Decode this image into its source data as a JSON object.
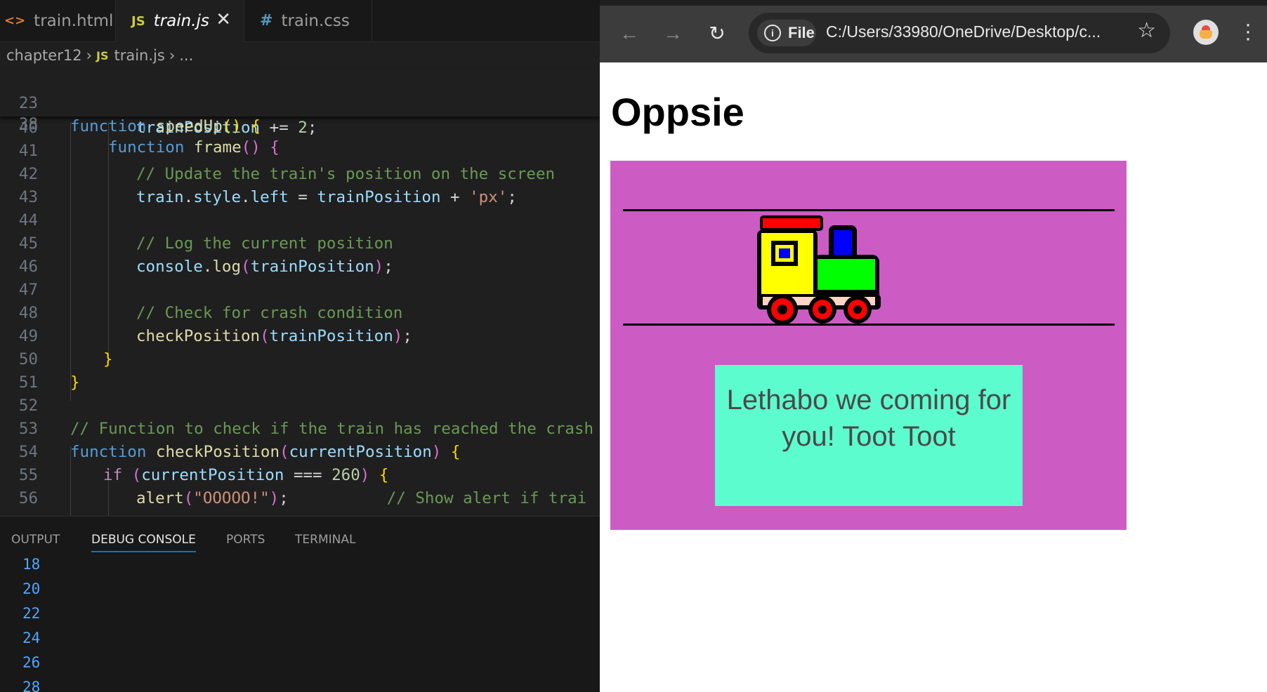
{
  "editor": {
    "tabs": [
      {
        "icon": "<>",
        "label": "train.html"
      },
      {
        "icon": "JS",
        "label": "train.js"
      },
      {
        "icon": "#",
        "label": "train.css"
      }
    ],
    "active_tab_close": "✕",
    "breadcrumb": {
      "folder": "chapter12",
      "file_icon": "JS",
      "file": "train.js",
      "more": "..."
    },
    "sticky_lines": [
      {
        "n": "23",
        "text": "function speedUp() {"
      },
      {
        "n": "38",
        "text": "function frame() {"
      }
    ],
    "code_lines": [
      {
        "n": "40",
        "text": "trainPosition += 2;"
      },
      {
        "n": "41",
        "text": ""
      },
      {
        "n": "42",
        "text": "// Update the train's position on the screen"
      },
      {
        "n": "43",
        "text": "train.style.left = trainPosition + 'px';"
      },
      {
        "n": "44",
        "text": ""
      },
      {
        "n": "45",
        "text": "// Log the current position"
      },
      {
        "n": "46",
        "text": "console.log(trainPosition);"
      },
      {
        "n": "47",
        "text": ""
      },
      {
        "n": "48",
        "text": "// Check for crash condition"
      },
      {
        "n": "49",
        "text": "checkPosition(trainPosition);"
      },
      {
        "n": "50",
        "text": "}"
      },
      {
        "n": "51",
        "text": "}"
      },
      {
        "n": "52",
        "text": ""
      },
      {
        "n": "53",
        "text": "// Function to check if the train has reached the crash"
      },
      {
        "n": "54",
        "text": "function checkPosition(currentPosition) {"
      },
      {
        "n": "55",
        "text": "if (currentPosition === 260) {"
      },
      {
        "n": "56",
        "text": "alert(\"OOOOO!\"); // Show alert if trai"
      }
    ],
    "panel_tabs": [
      "OUTPUT",
      "DEBUG CONSOLE",
      "PORTS",
      "TERMINAL"
    ],
    "active_panel_tab": "DEBUG CONSOLE",
    "debug_output": [
      "18",
      "20",
      "22",
      "24",
      "26",
      "28"
    ]
  },
  "browser": {
    "back_icon": "arrow-left-icon",
    "forward_icon": "arrow-right-icon",
    "reload_icon": "reload-icon",
    "site_chip": "File",
    "url": "C:/Users/33980/OneDrive/Desktop/c...",
    "bookmark_icon": "star-icon",
    "profile_icon": "profile-avatar-icon",
    "menu_icon": "kebab-menu-icon"
  },
  "page": {
    "title": "Oppsie",
    "stage_color": "#cc5bc4",
    "message_box_color": "#5dfccf",
    "message": "Lethabo we coming for you! Toot Toot"
  }
}
